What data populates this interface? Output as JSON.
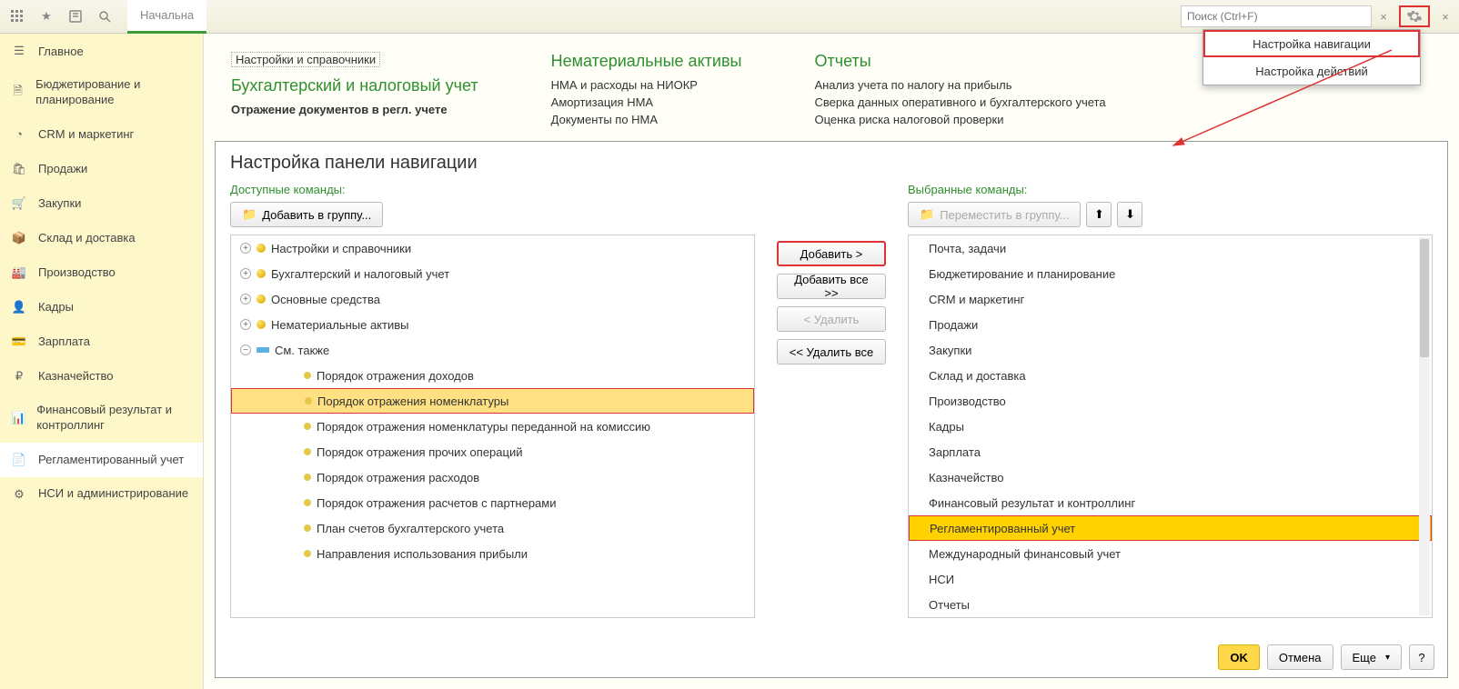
{
  "toolbar": {
    "tab_active": "Начальна",
    "search_placeholder": "Поиск (Ctrl+F)"
  },
  "sidebar": {
    "items": [
      {
        "label": "Главное"
      },
      {
        "label": "Бюджетирование и планирование"
      },
      {
        "label": "CRM и маркетинг"
      },
      {
        "label": "Продажи"
      },
      {
        "label": "Закупки"
      },
      {
        "label": "Склад и доставка"
      },
      {
        "label": "Производство"
      },
      {
        "label": "Кадры"
      },
      {
        "label": "Зарплата"
      },
      {
        "label": "Казначейство"
      },
      {
        "label": "Финансовый результат и контроллинг"
      },
      {
        "label": "Регламентированный учет"
      },
      {
        "label": "НСИ и администрирование"
      }
    ]
  },
  "content": {
    "settings_link": "Настройки и справочники",
    "col1_title": "Бухгалтерский и налоговый учет",
    "col1_item1": "Отражение документов в регл. учете",
    "col2_title": "Нематериальные активы",
    "col2_item1": "НМА и расходы на НИОКР",
    "col2_item2": "Амортизация НМА",
    "col2_item3": "Документы по НМА",
    "col3_title": "Отчеты",
    "col3_item1": "Анализ учета по налогу на прибыль",
    "col3_item2": "Сверка данных оперативного и бухгалтерского учета",
    "col3_item3": "Оценка риска налоговой проверки"
  },
  "settings_menu": {
    "item1": "Настройка навигации",
    "item2": "Настройка действий"
  },
  "dialog": {
    "title": "Настройка панели навигации",
    "available_label": "Доступные команды:",
    "selected_label": "Выбранные команды:",
    "add_to_group": "Добавить в группу...",
    "move_to_group": "Переместить в группу...",
    "btn_add": "Добавить >",
    "btn_add_all": "Добавить все >>",
    "btn_remove": "< Удалить",
    "btn_remove_all": "<< Удалить все",
    "ok": "OK",
    "cancel": "Отмена",
    "more": "Еще",
    "help": "?",
    "tree": [
      {
        "label": "Настройки и справочники"
      },
      {
        "label": "Бухгалтерский и налоговый учет"
      },
      {
        "label": "Основные средства"
      },
      {
        "label": "Нематериальные активы"
      },
      {
        "label": "См. также"
      },
      {
        "label": "Порядок отражения доходов"
      },
      {
        "label": "Порядок отражения номенклатуры"
      },
      {
        "label": "Порядок отражения номенклатуры переданной на комиссию"
      },
      {
        "label": "Порядок отражения прочих операций"
      },
      {
        "label": "Порядок отражения расходов"
      },
      {
        "label": "Порядок отражения расчетов с партнерами"
      },
      {
        "label": "План счетов бухгалтерского учета"
      },
      {
        "label": "Направления использования прибыли"
      }
    ],
    "selected": [
      "Почта, задачи",
      "Бюджетирование и планирование",
      "CRM и маркетинг",
      "Продажи",
      "Закупки",
      "Склад и доставка",
      "Производство",
      "Кадры",
      "Зарплата",
      "Казначейство",
      "Финансовый результат и контроллинг",
      "Регламентированный учет",
      "Международный финансовый учет",
      "НСИ",
      "Отчеты"
    ]
  }
}
